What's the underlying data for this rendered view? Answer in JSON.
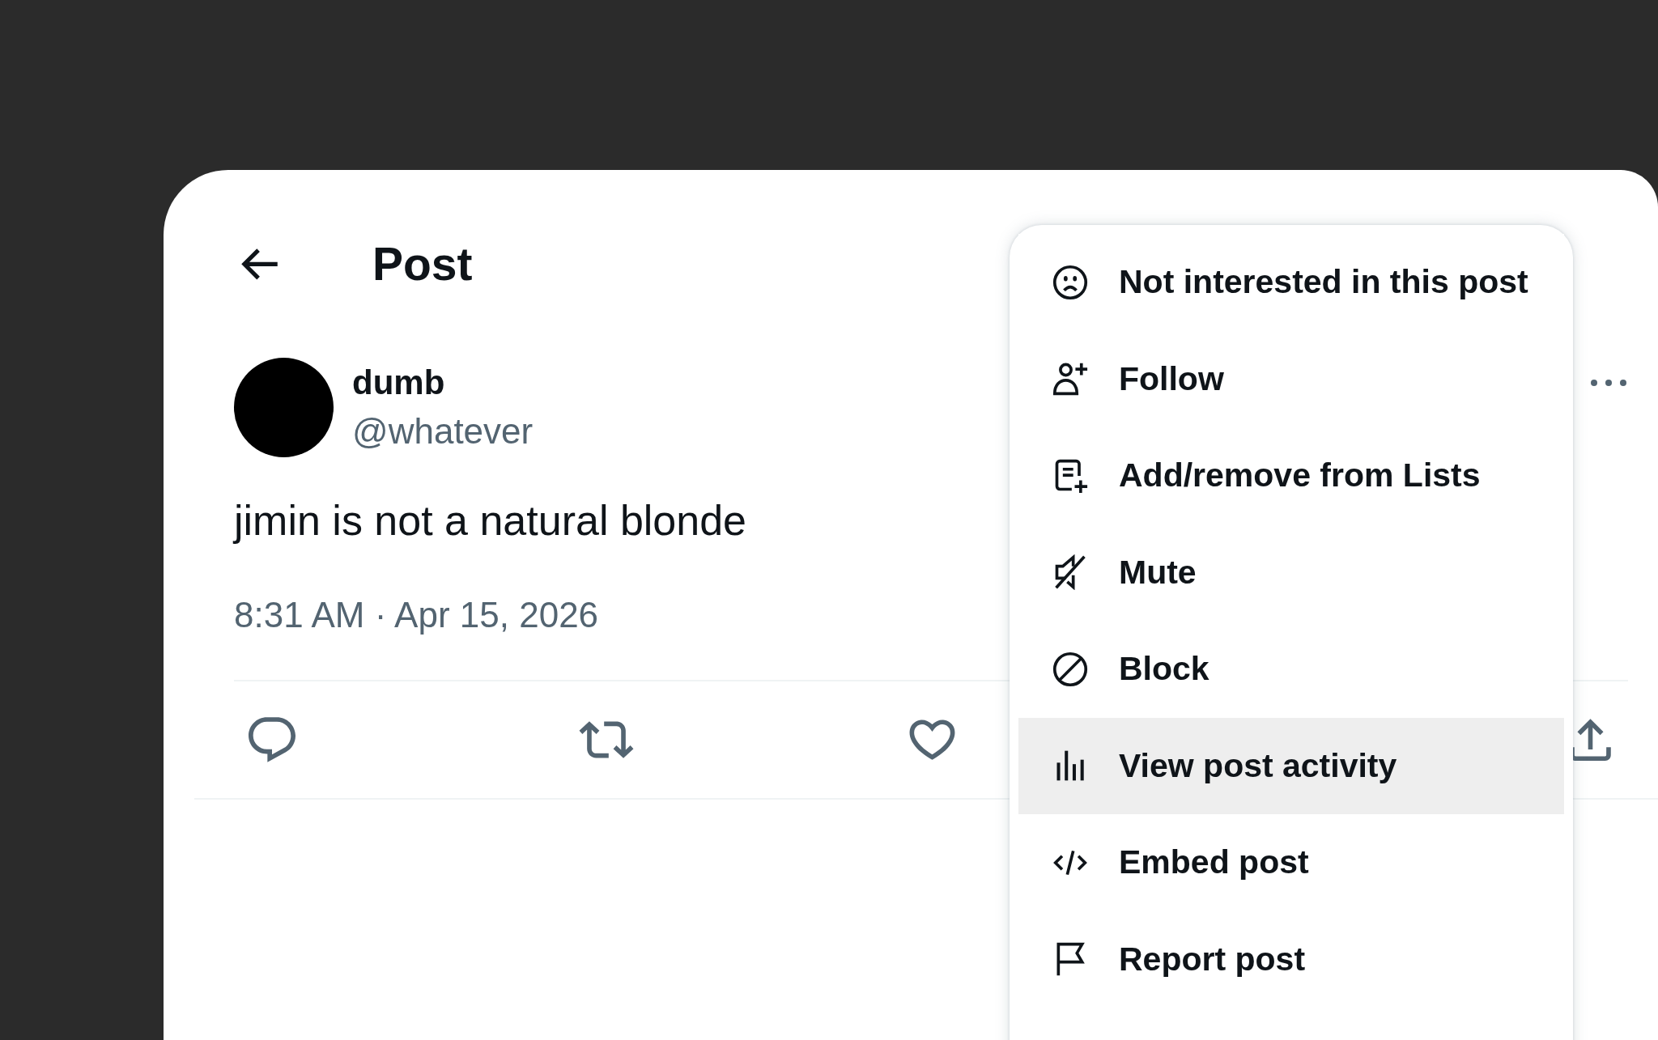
{
  "header": {
    "title": "Post"
  },
  "post": {
    "author": {
      "name": "dumb",
      "handle": "@whatever"
    },
    "text": "jimin is not a natural blonde",
    "timestamp": "8:31 AM · Apr 15, 2026"
  },
  "menu": {
    "items": [
      {
        "label": "Not interested in this post",
        "highlighted": false
      },
      {
        "label": "Follow",
        "highlighted": false
      },
      {
        "label": "Add/remove from Lists",
        "highlighted": false
      },
      {
        "label": "Mute",
        "highlighted": false
      },
      {
        "label": "Block",
        "highlighted": false
      },
      {
        "label": "View post activity",
        "highlighted": true
      },
      {
        "label": "Embed post",
        "highlighted": false
      },
      {
        "label": "Report post",
        "highlighted": false
      }
    ]
  }
}
